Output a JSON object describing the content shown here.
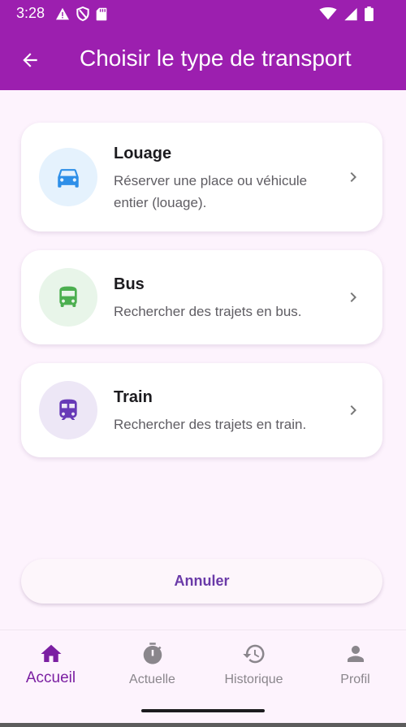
{
  "status_bar": {
    "time": "3:28",
    "icons": [
      "warning-icon",
      "shield-icon",
      "sd-card-icon",
      "wifi-icon",
      "signal-icon",
      "battery-icon"
    ]
  },
  "app_bar": {
    "back_icon": "arrow-left-icon",
    "title": "Choisir le type de transport",
    "background": "#9c1faf"
  },
  "options": [
    {
      "title": "Louage",
      "description": "Réserver une place ou véhicule entier (louage).",
      "icon": "car-icon",
      "icon_color": "#2e8fe8",
      "circle_color": "#e5f2fd"
    },
    {
      "title": "Bus",
      "description": "Rechercher des trajets en bus.",
      "icon": "bus-icon",
      "icon_color": "#4caf50",
      "circle_color": "#e8f5e9"
    },
    {
      "title": "Train",
      "description": "Rechercher des trajets en train.",
      "icon": "train-icon",
      "icon_color": "#673ab7",
      "circle_color": "#ede7f6"
    }
  ],
  "cancel_button": {
    "label": "Annuler"
  },
  "bottom_nav": {
    "active_color": "#7b1fa2",
    "items": [
      {
        "label": "Accueil",
        "icon": "home-icon",
        "active": true
      },
      {
        "label": "Actuelle",
        "icon": "timer-icon",
        "active": false
      },
      {
        "label": "Historique",
        "icon": "history-icon",
        "active": false
      },
      {
        "label": "Profil",
        "icon": "person-icon",
        "active": false
      }
    ]
  }
}
